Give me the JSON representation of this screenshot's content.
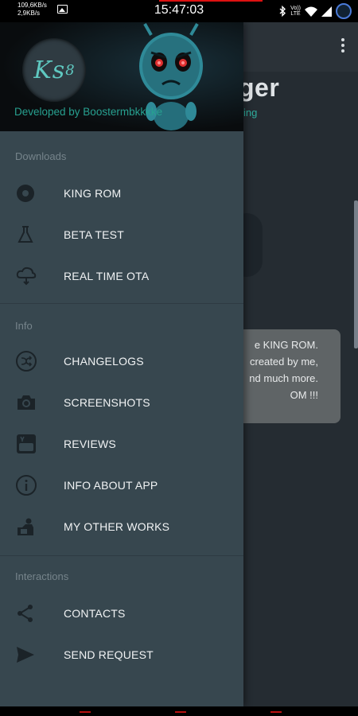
{
  "status_bar": {
    "net_up": "109,6KB/s",
    "net_down": "2,9KB/s",
    "time": "15:47:03",
    "icons": [
      "image-icon",
      "bluetooth-icon",
      "volte-icon",
      "wifi-icon",
      "signal-icon",
      "avatar-icon"
    ],
    "volte_top": "Vo))",
    "volte_bottom": "LTE"
  },
  "background_app": {
    "title_fragment": "ger",
    "subtitle_fragment": "ing",
    "card_lines": [
      "e KING ROM.",
      "created by me,",
      "nd much more.",
      "OM !!!"
    ]
  },
  "drawer": {
    "header": {
      "logo_text": "Ks",
      "logo_sub": "8",
      "developer_credit": "Developed by Boostermbkkkke"
    },
    "sections": [
      {
        "title": "Downloads",
        "items": [
          {
            "label": "KING ROM",
            "icon": "disc-icon"
          },
          {
            "label": "BETA TEST",
            "icon": "flask-icon"
          },
          {
            "label": "REAL TIME OTA",
            "icon": "cloud-icon"
          }
        ]
      },
      {
        "title": "Info",
        "items": [
          {
            "label": "CHANGELOGS",
            "icon": "shuffle-icon"
          },
          {
            "label": "SCREENSHOTS",
            "icon": "camera-icon"
          },
          {
            "label": "REVIEWS",
            "icon": "youtube-icon"
          },
          {
            "label": "INFO ABOUT APP",
            "icon": "info-icon"
          },
          {
            "label": "MY OTHER WORKS",
            "icon": "worker-icon"
          }
        ]
      },
      {
        "title": "Interactions",
        "items": [
          {
            "label": "CONTACTS",
            "icon": "share-icon"
          },
          {
            "label": "SEND REQUEST",
            "icon": "send-icon"
          }
        ]
      }
    ]
  },
  "colors": {
    "drawer_bg": "#37474f",
    "accent": "#27a08f",
    "text": "#f1f3f4",
    "section_title": "#76848b"
  }
}
